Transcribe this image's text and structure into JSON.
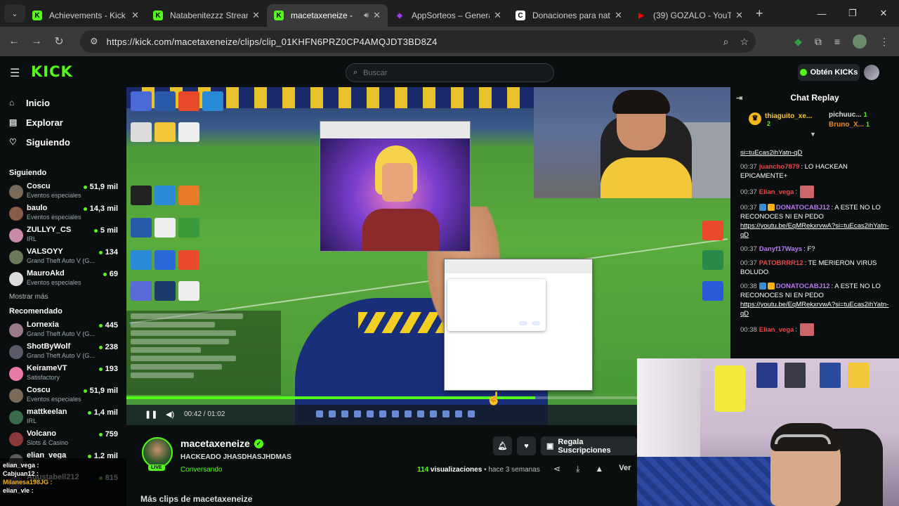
{
  "browser": {
    "tabs": [
      {
        "title": "Achievements - Kick",
        "fav_color": "#53fc18",
        "fav_letter": "K",
        "active": false
      },
      {
        "title": "Natabenitezzz Stream",
        "fav_color": "#53fc18",
        "fav_letter": "K",
        "active": false
      },
      {
        "title": "macetaxeneize -",
        "fav_color": "#53fc18",
        "fav_letter": "K",
        "active": true
      },
      {
        "title": "AppSorteos – Genera",
        "fav_color": "#9b3ef0",
        "fav_letter": "◆",
        "active": false
      },
      {
        "title": "Donaciones para nat",
        "fav_color": "#ffffff",
        "fav_letter": "C",
        "active": false
      },
      {
        "title": "(39) GOZALO - YouTu",
        "fav_color": "#ff0000",
        "fav_letter": "▶",
        "active": false
      }
    ],
    "url": "https://kick.com/macetaxeneize/clips/clip_01KHFN6PRZ0CP4AMQJDT3BD8Z4"
  },
  "kick": {
    "logo": "KICK",
    "search_placeholder": "Buscar",
    "get_kicks": "Obtén KICKs",
    "nav": [
      {
        "label": "Inicio",
        "icon": "home-icon",
        "glyph": "⌂"
      },
      {
        "label": "Explorar",
        "icon": "compass-icon",
        "glyph": "▤"
      },
      {
        "label": "Siguiendo",
        "icon": "heart-icon",
        "glyph": "♡"
      }
    ],
    "following_title": "Siguiendo",
    "following": [
      {
        "name": "Coscu",
        "category": "Eventos especiales",
        "viewers": "51,9 mil",
        "color": "#7a6a5a"
      },
      {
        "name": "baulo",
        "category": "Eventos especiales",
        "viewers": "14,3 mil",
        "color": "#8a5a4a"
      },
      {
        "name": "ZULLYY_CS",
        "category": "IRL",
        "viewers": "5 mil",
        "color": "#c88aa8"
      },
      {
        "name": "VALSOYY",
        "category": "Grand Theft Auto V (G...",
        "viewers": "134",
        "color": "#6a7a5a"
      },
      {
        "name": "MauroAkd",
        "category": "Eventos especiales",
        "viewers": "69",
        "color": "#dddddd"
      }
    ],
    "show_more": "Mostrar más",
    "recommended_title": "Recomendado",
    "recommended": [
      {
        "name": "Lornexia",
        "category": "Grand Theft Auto V (G...",
        "viewers": "445",
        "color": "#9a7a8a"
      },
      {
        "name": "ShotByWolf",
        "category": "Grand Theft Auto V (G...",
        "viewers": "238",
        "color": "#5a5a6a"
      },
      {
        "name": "KeirameVT",
        "category": "Satisfactory",
        "viewers": "193",
        "color": "#e87aa8"
      },
      {
        "name": "Coscu",
        "category": "Eventos especiales",
        "viewers": "51,9 mil",
        "color": "#7a6a5a"
      },
      {
        "name": "mattkeelan",
        "category": "IRL",
        "viewers": "1,4 mil",
        "color": "#3a6a4a"
      },
      {
        "name": "Volcano",
        "category": "Slots & Casino",
        "viewers": "759",
        "color": "#8a3a3a"
      },
      {
        "name": "elian_vega",
        "category": "",
        "viewers": "1,2 mil",
        "color": "#5a5a5a"
      },
      {
        "name": "Agustabell212",
        "category": "",
        "viewers": "815",
        "color": "#5a4a6a"
      }
    ],
    "video": {
      "time": "00:42 / 01:02",
      "progress": 0.677
    },
    "channel": {
      "name": "macetaxeneize",
      "live": "LIVE",
      "title": "HACKEADO JHASDHASJHDMAS",
      "category": "Conversando",
      "views_count": "114",
      "views_label": "visualizaciones",
      "time_ago": "hace 3 semanas",
      "gift_subs": "Regala Suscripciones",
      "more_clips": "Más clips de macetaxeneize",
      "ver": "Ver"
    },
    "chat": {
      "title": "Chat Replay",
      "pinned": {
        "user1": "thiaguito_xe...",
        "user1_count": "2",
        "user2": "pichuuc...",
        "user2_count": "1",
        "user3": "Bruno_X...",
        "user3_count": "1"
      },
      "messages": [
        {
          "time": "",
          "user": "",
          "user_color": "#ffffff",
          "text": "",
          "link": "si=tuEcas2ihYatn-qD",
          "badges": []
        },
        {
          "time": "00:37",
          "user": "juancho7879",
          "user_color": "#e84a4a",
          "text": ": LO HACKEAN EPICAMENTE+",
          "link": "",
          "badges": []
        },
        {
          "time": "00:37",
          "user": "Elian_vega",
          "user_color": "#e84a4a",
          "text": ":",
          "link": "",
          "badges": []
        },
        {
          "time": "00:37",
          "user": "DONATOCABJ12",
          "user_color": "#b77af0",
          "text": ": A ESTE NO LO RECONOCES NI EN PEDO",
          "link": "https://youtu.be/EqMRekxrvwA?si=tuEcas2ihYatn-qD",
          "badges": [
            "#3a8ad8",
            "#f2b51a"
          ]
        },
        {
          "time": "00:37",
          "user": "Danyf17Ways",
          "user_color": "#b77af0",
          "text": ": F?",
          "link": "",
          "badges": []
        },
        {
          "time": "00:37",
          "user": "PATOBRRR12",
          "user_color": "#e84a4a",
          "text": ": TE MERIERON VIRUS BOLUDO",
          "link": "",
          "badges": []
        },
        {
          "time": "00:38",
          "user": "DONATOCABJ12",
          "user_color": "#b77af0",
          "text": ": A ESTE NO LO RECONOCES NI EN PEDO",
          "link": "https://youtu.be/EqMRekxrvwA?si=tuEcas2ihYatn-qD",
          "badges": [
            "#3a8ad8",
            "#f2b51a"
          ]
        },
        {
          "time": "00:38",
          "user": "Elian_vega",
          "user_color": "#e84a4a",
          "text": ":",
          "link": "",
          "badges": []
        }
      ]
    },
    "bottom_chat": [
      {
        "user": "elian_vega :",
        "color": "#ffffff"
      },
      {
        "user": "Cabjuan12 :",
        "color": "#ffffff"
      },
      {
        "user": "Milanesa198JG :",
        "color": "#f2b51a"
      },
      {
        "user": "elian_vle :",
        "color": "#ffffff"
      }
    ]
  }
}
